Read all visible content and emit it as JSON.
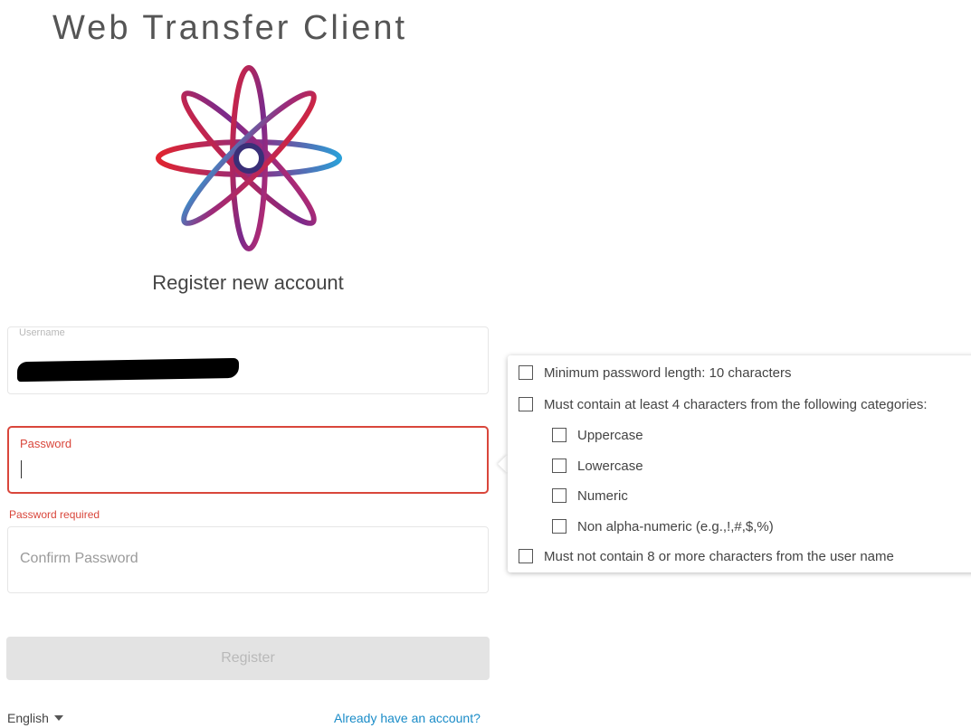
{
  "app_title": "Web Transfer Client",
  "subtitle": "Register new account",
  "form": {
    "username_label": "Username",
    "password_label": "Password",
    "password_error": "Password required",
    "confirm_placeholder": "Confirm Password",
    "register_label": "Register"
  },
  "footer": {
    "language": "English",
    "already_link": "Already have an account?"
  },
  "password_rules": {
    "min_length": "Minimum password length: 10 characters",
    "categories": "Must contain at least 4 characters from the following categories:",
    "uppercase": "Uppercase",
    "lowercase": "Lowercase",
    "numeric": "Numeric",
    "non_alpha": "Non alpha-numeric (e.g.,!,#,$,%)",
    "no_username": "Must not contain 8 or more characters from the user name"
  },
  "colors": {
    "error": "#d9463b",
    "link": "#1a8cc8",
    "logo_red": "#e0242f",
    "logo_purple": "#7a2a8c",
    "logo_blue": "#2a9fd8"
  }
}
